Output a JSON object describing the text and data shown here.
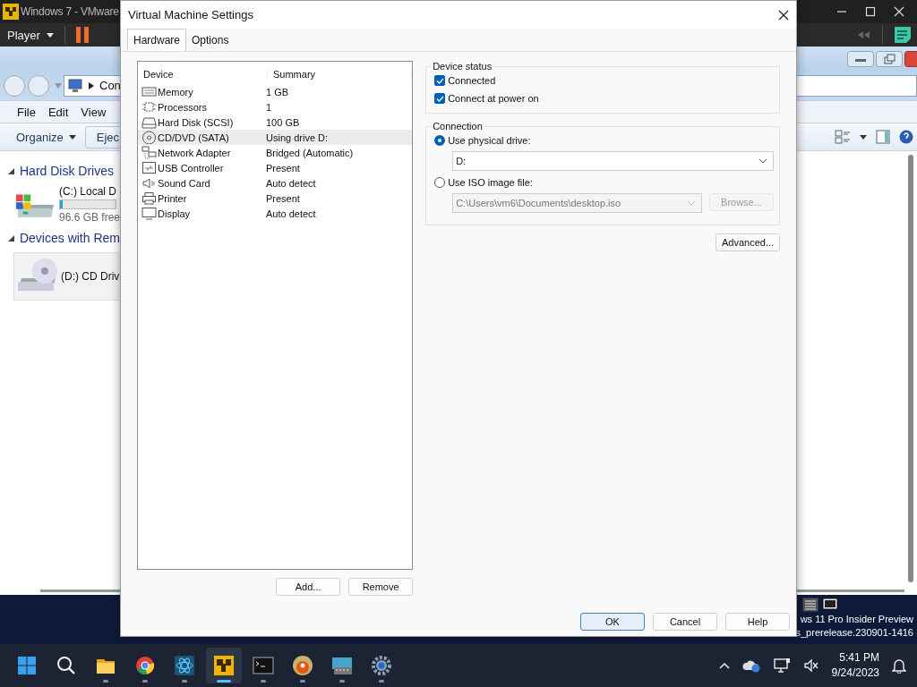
{
  "host_window": {
    "title": "Windows 7 - VMware",
    "player_menu": "Player"
  },
  "guest_explorer": {
    "address": "Con",
    "menu": [
      "File",
      "Edit",
      "View"
    ],
    "toolbar": [
      "Organize",
      "Ejec"
    ],
    "sections": [
      {
        "title": "Hard Disk Drives",
        "drives": [
          {
            "kind": "hdd",
            "name": "(C:) Local D",
            "free": "96.6 GB free",
            "level": 0.05
          }
        ]
      },
      {
        "title": "Devices with Rem",
        "drives": [
          {
            "kind": "cd",
            "name": "(D:) CD Driv"
          }
        ]
      }
    ]
  },
  "dialog": {
    "title": "Virtual Machine Settings",
    "tabs": [
      {
        "label": "Hardware",
        "selected": true
      },
      {
        "label": "Options",
        "selected": false
      }
    ],
    "device_list": {
      "columns": [
        "Device",
        "Summary"
      ],
      "rows": [
        {
          "kind": "memory",
          "device": "Memory",
          "summary": "1 GB",
          "selected": false
        },
        {
          "kind": "cpu",
          "device": "Processors",
          "summary": "1",
          "selected": false
        },
        {
          "kind": "disk",
          "device": "Hard Disk (SCSI)",
          "summary": "100 GB",
          "selected": false
        },
        {
          "kind": "cd",
          "device": "CD/DVD (SATA)",
          "summary": "Using drive D:",
          "selected": true
        },
        {
          "kind": "network",
          "device": "Network Adapter",
          "summary": "Bridged (Automatic)",
          "selected": false
        },
        {
          "kind": "usb",
          "device": "USB Controller",
          "summary": "Present",
          "selected": false
        },
        {
          "kind": "sound",
          "device": "Sound Card",
          "summary": "Auto detect",
          "selected": false
        },
        {
          "kind": "printer",
          "device": "Printer",
          "summary": "Present",
          "selected": false
        },
        {
          "kind": "display",
          "device": "Display",
          "summary": "Auto detect",
          "selected": false
        }
      ]
    },
    "list_buttons": [
      "Add...",
      "Remove"
    ],
    "device_status": {
      "title": "Device status",
      "options": [
        {
          "label": "Connected",
          "checked": true
        },
        {
          "label": "Connect at power on",
          "checked": true
        }
      ]
    },
    "connection": {
      "title": "Connection",
      "options": [
        {
          "label": "Use physical drive:",
          "selected": true,
          "field": {
            "value": "D:",
            "disabled": false
          }
        },
        {
          "label": "Use ISO image file:",
          "selected": false,
          "field": {
            "value": "C:\\Users\\vm6\\Documents\\desktop.iso",
            "disabled": true
          },
          "button": "Browse..."
        }
      ]
    },
    "advanced_button": "Advanced...",
    "footer_buttons": [
      {
        "label": "OK",
        "focused": true
      },
      {
        "label": "Cancel",
        "focused": false
      },
      {
        "label": "Help",
        "focused": false
      }
    ]
  },
  "desktop": {
    "build_text": [
      "ws 11 Pro Insider Preview",
      "s_prerelease.230901-1416"
    ]
  },
  "taskbar": {
    "apps": [
      {
        "kind": "start",
        "active": false
      },
      {
        "kind": "search",
        "active": false
      },
      {
        "kind": "folder",
        "active": false
      },
      {
        "kind": "browser",
        "active": false
      },
      {
        "kind": "atom",
        "active": false
      },
      {
        "kind": "vmware",
        "active": true
      },
      {
        "kind": "terminal",
        "active": false
      },
      {
        "kind": "disc",
        "active": false
      },
      {
        "kind": "keyboard",
        "active": false
      },
      {
        "kind": "settings",
        "active": false
      }
    ],
    "time": "5:41 PM",
    "date": "9/24/2023"
  }
}
